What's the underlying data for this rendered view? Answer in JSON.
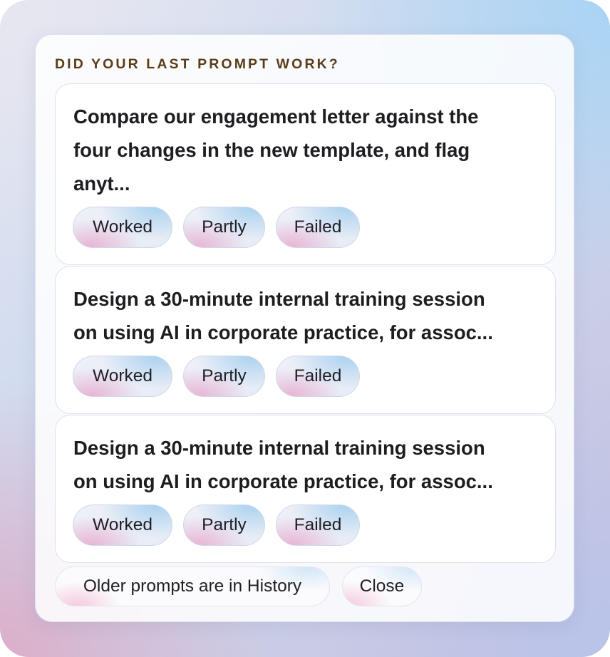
{
  "heading": "DID YOUR LAST PROMPT WORK?",
  "prompts": [
    {
      "text": "Compare our engagement letter against the\nfour changes in the new template, and flag\nanyt...",
      "actions": {
        "worked": "Worked",
        "partly": "Partly",
        "failed": "Failed"
      }
    },
    {
      "text": "Design a 30-minute internal training session\non using AI in corporate practice, for assoc...",
      "actions": {
        "worked": "Worked",
        "partly": "Partly",
        "failed": "Failed"
      }
    },
    {
      "text": "Design a 30-minute internal training session\non using AI in corporate practice, for assoc...",
      "actions": {
        "worked": "Worked",
        "partly": "Partly",
        "failed": "Failed"
      }
    }
  ],
  "footer": {
    "history_label": "Older prompts are in History",
    "close_label": "Close"
  }
}
